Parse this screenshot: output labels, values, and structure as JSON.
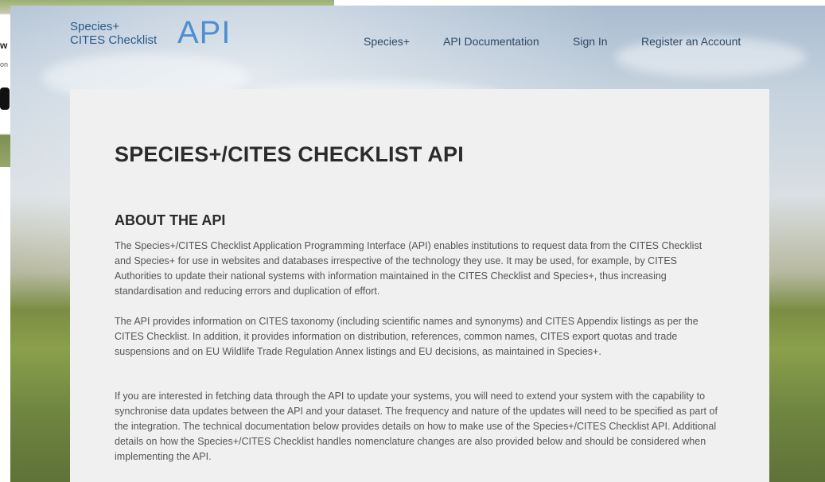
{
  "background_window": {
    "fragment_heading": "w",
    "fragment_text": "on :"
  },
  "logo": {
    "line1": "Species+",
    "line2": "CITES Checklist",
    "api": "API"
  },
  "nav": {
    "items": [
      {
        "label": "Species+"
      },
      {
        "label": "API Documentation"
      },
      {
        "label": "Sign In"
      },
      {
        "label": "Register an Account"
      }
    ]
  },
  "main": {
    "title": "SPECIES+/CITES CHECKLIST API",
    "section_heading": "ABOUT THE API",
    "paragraphs": [
      "The Species+/CITES Checklist Application Programming Interface (API) enables institutions to request data from the CITES Checklist and Species+ for use in websites and databases irrespective of the technology they use. It may be used, for example, by CITES Authorities to update their national systems with information maintained in the CITES Checklist and Species+, thus increasing standardisation and reducing errors and duplication of effort.",
      "The API provides information on CITES taxonomy (including scientific names and synonyms) and CITES Appendix listings as per the CITES Checklist. In addition, it provides information on distribution, references, common names, CITES export quotas and trade suspensions and on EU Wildlife Trade Regulation Annex listings and EU decisions, as maintained in Species+.",
      "If you are interested in fetching data through the API to update your systems, you will need to extend your system with the capability to synchronise data updates between the API and your dataset. The frequency and nature of the updates will need to be specified as part of the integration. The technical documentation below provides details on how to make use of the Species+/CITES Checklist API. Additional details on how the Species+/CITES Checklist handles nomenclature changes are also provided below and should be considered when implementing the API."
    ]
  },
  "colors": {
    "panel_bg": "#f1f0f0",
    "title_text": "#2b2b2b",
    "body_text": "#555555",
    "nav_text": "#2e4a66",
    "logo_text": "#2a5b8a",
    "logo_api": "#4f8fd0"
  }
}
